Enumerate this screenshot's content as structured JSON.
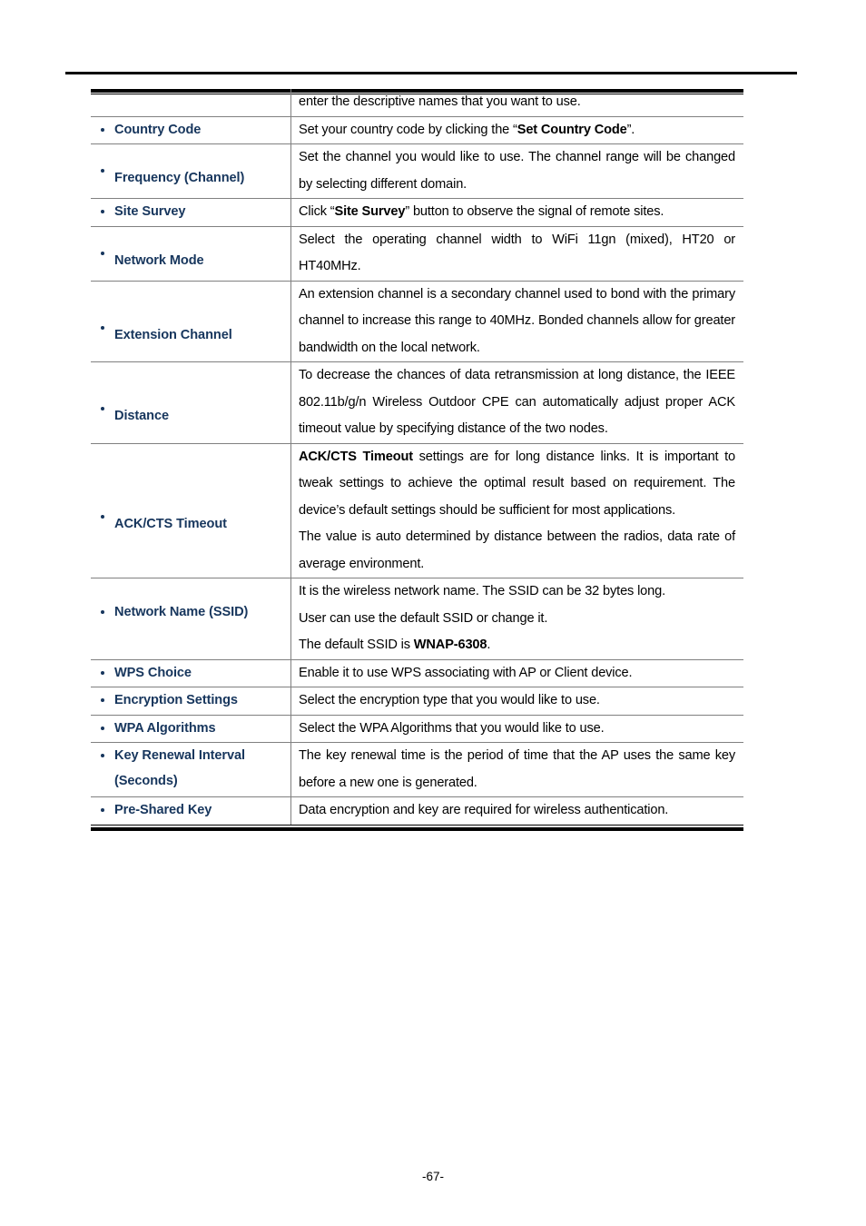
{
  "document": {
    "page_number": "-67-"
  },
  "table": {
    "rows": [
      {
        "term": "",
        "term_line2": "",
        "description": [
          "enter the descriptive names that you want to use."
        ]
      },
      {
        "term": "Country Code",
        "term_line2": "",
        "description": [
          "Set your country code by clicking the “Set Country Code”."
        ],
        "bold_spans": [
          "Set Country Code"
        ]
      },
      {
        "term": "Frequency (Channel)",
        "term_line2": "",
        "description": [
          "Set the channel you would like to use. The channel range will be changed by selecting different domain."
        ]
      },
      {
        "term": "Site Survey",
        "term_line2": "",
        "description": [
          "Click “Site Survey” button to observe the signal of remote sites."
        ],
        "bold_spans": [
          "Site Survey"
        ]
      },
      {
        "term": "Network Mode",
        "term_line2": "",
        "description": [
          "Select the operating channel width to WiFi 11gn (mixed),  HT20 or HT40MHz."
        ]
      },
      {
        "term": "Extension Channel",
        "term_line2": "",
        "description": [
          "An extension channel is a secondary channel used to bond with the primary channel to increase this range to 40MHz. Bonded channels allow for greater bandwidth on the local network."
        ]
      },
      {
        "term": "Distance",
        "term_line2": "",
        "description": [
          "To decrease the chances of data retransmission at long distance, the IEEE 802.11b/g/n Wireless Outdoor CPE can automatically adjust proper ACK timeout value by specifying distance of the two nodes."
        ]
      },
      {
        "term": "ACK/CTS Timeout",
        "term_line2": "",
        "description": [
          "ACK/CTS Timeout settings are for long distance links. It is important to tweak settings to achieve the optimal result based on requirement. The device’s default settings should be sufficient for most applications.",
          "The value is auto determined by distance between the radios, data rate of average environment."
        ],
        "bold_spans": [
          "ACK/CTS Timeout"
        ]
      },
      {
        "term": "Network Name (SSID)",
        "term_line2": "",
        "description": [
          "It is the wireless network name. The SSID can be 32 bytes long.",
          "User can use the default SSID or change it.",
          "The default SSID is WNAP-6308."
        ],
        "bold_spans": [
          "WNAP-6308"
        ]
      },
      {
        "term": "WPS Choice",
        "term_line2": "",
        "description": [
          "Enable it to use WPS associating with AP or Client device."
        ]
      },
      {
        "term": "Encryption Settings",
        "term_line2": "",
        "description": [
          "Select the encryption type that you would like to use."
        ]
      },
      {
        "term": "WPA Algorithms",
        "term_line2": "",
        "description": [
          "Select the WPA Algorithms that you would like to use."
        ]
      },
      {
        "term": "Key Renewal Interval",
        "term_line2": "(Seconds)",
        "description": [
          "The key renewal time is the period of time that the AP uses the same key before a new one is generated."
        ]
      },
      {
        "term": "Pre-Shared Key",
        "term_line2": "",
        "description": [
          "Data encryption and key are required for wireless authentication."
        ]
      }
    ]
  },
  "colors": {
    "term_blue": "#17365D",
    "rule_black": "#000000",
    "row_divider_gray": "#808080"
  }
}
